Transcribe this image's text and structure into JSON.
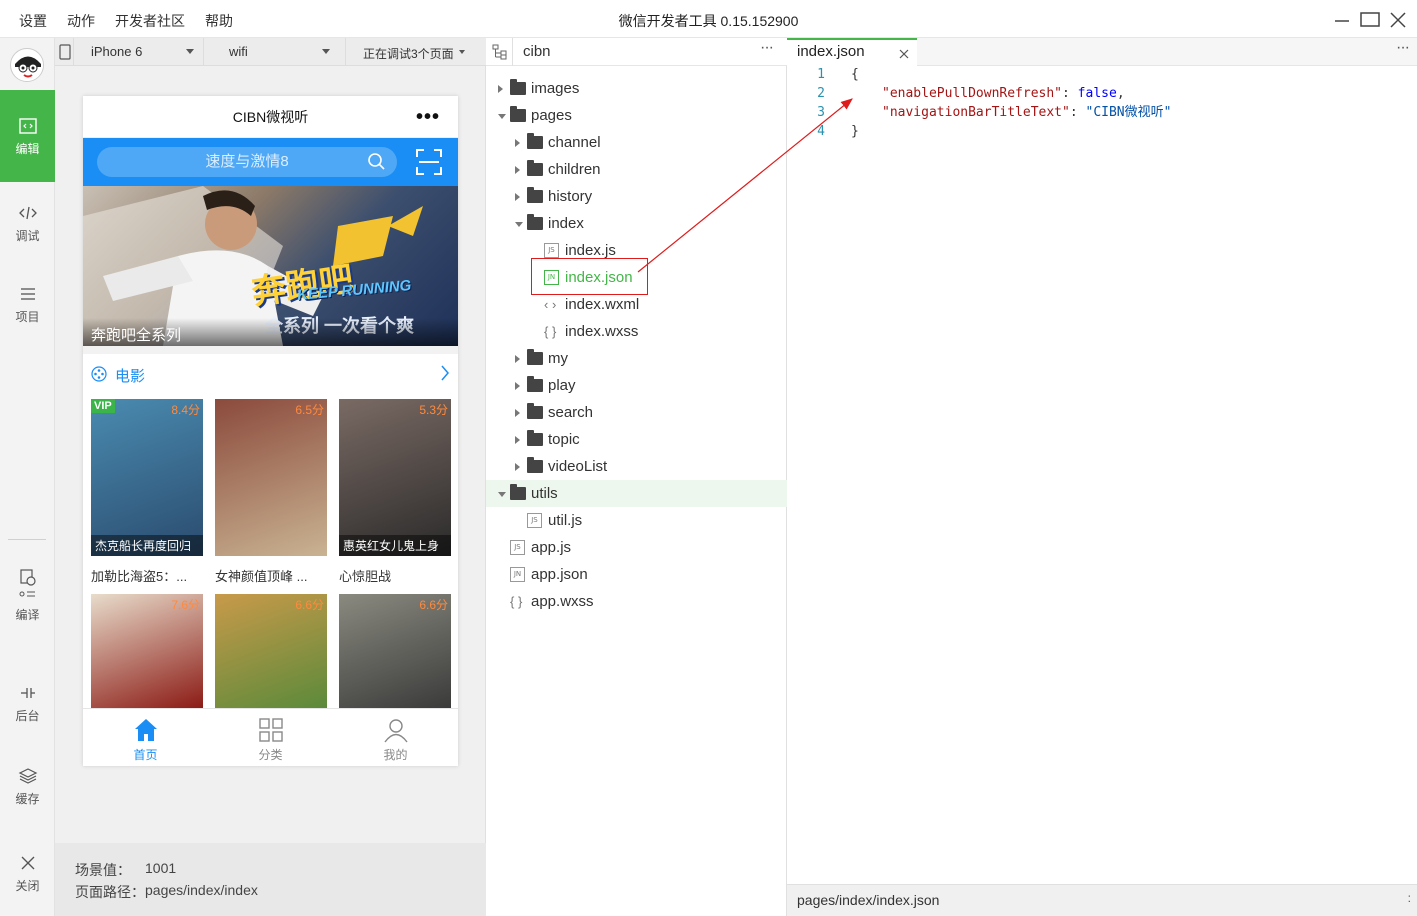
{
  "menu": [
    "设置",
    "动作",
    "开发者社区",
    "帮助"
  ],
  "app_title": "微信开发者工具 0.15.152900",
  "sidebar": {
    "items": [
      {
        "label": "编辑",
        "icon": "code-brackets-icon",
        "active": true
      },
      {
        "label": "调试",
        "icon": "debug-code-icon"
      },
      {
        "label": "项目",
        "icon": "menu-lines-icon"
      },
      {
        "label": "编译",
        "icon": "compile-icon"
      },
      {
        "label": "后台",
        "icon": "background-icon"
      },
      {
        "label": "缓存",
        "icon": "layers-icon"
      },
      {
        "label": "关闭",
        "icon": "close-icon"
      }
    ]
  },
  "simulator": {
    "device": "iPhone 6",
    "network": "wifi",
    "debug_status": "正在调试3个页面",
    "nav_title": "CIBN微视听",
    "search_placeholder": "速度与激情8",
    "banner_caption": "奔跑吧全系列",
    "banner_logo": "奔跑吧",
    "banner_logo_en": "KEEP RUNNING",
    "banner_slogan": "全系列 一次看个爽",
    "section_title": "电影",
    "movies": [
      {
        "title": "加勒比海盗5：...",
        "score": "8.4分",
        "badge": "VIP",
        "caption": "杰克船长再度回归",
        "colors": [
          "#2a4b6e",
          "#4a8bb0"
        ]
      },
      {
        "title": "女神颜值顶峰 ...",
        "score": "6.5分",
        "badge": "",
        "caption": "",
        "colors": [
          "#c9b392",
          "#8b4a3c"
        ]
      },
      {
        "title": "心惊胆战",
        "score": "5.3分",
        "badge": "",
        "caption": "惠英红女儿鬼上身",
        "colors": [
          "#2a2a2a",
          "#7a6a64"
        ]
      },
      {
        "title": "",
        "score": "7.6分",
        "badge": "",
        "caption": "",
        "colors": [
          "#8b1a14",
          "#e8dccb"
        ]
      },
      {
        "title": "",
        "score": "6.6分",
        "badge": "",
        "caption": "",
        "colors": [
          "#5a8a3a",
          "#c89a4a"
        ]
      },
      {
        "title": "",
        "score": "6.6分",
        "badge": "",
        "caption": "",
        "colors": [
          "#3a3a3a",
          "#8a8a80"
        ]
      }
    ],
    "tabs": [
      {
        "label": "首页",
        "icon": "home-icon",
        "active": true
      },
      {
        "label": "分类",
        "icon": "grid-icon",
        "active": false
      },
      {
        "label": "我的",
        "icon": "user-icon",
        "active": false
      }
    ],
    "scene_label": "场景值：",
    "scene_value": "1001",
    "path_label": "页面路径：",
    "path_value": "pages/index/index"
  },
  "project": {
    "name": "cibn",
    "tree": [
      {
        "name": "images",
        "type": "folder",
        "depth": 0,
        "expanded": false
      },
      {
        "name": "pages",
        "type": "folder",
        "depth": 0,
        "expanded": true
      },
      {
        "name": "channel",
        "type": "folder",
        "depth": 1,
        "expanded": false
      },
      {
        "name": "children",
        "type": "folder",
        "depth": 1,
        "expanded": false
      },
      {
        "name": "history",
        "type": "folder",
        "depth": 1,
        "expanded": false
      },
      {
        "name": "index",
        "type": "folder",
        "depth": 1,
        "expanded": true
      },
      {
        "name": "index.js",
        "type": "js",
        "depth": 2
      },
      {
        "name": "index.json",
        "type": "json",
        "depth": 2,
        "highlight": true
      },
      {
        "name": "index.wxml",
        "type": "wxml",
        "depth": 2
      },
      {
        "name": "index.wxss",
        "type": "wxss",
        "depth": 2
      },
      {
        "name": "my",
        "type": "folder",
        "depth": 1,
        "expanded": false
      },
      {
        "name": "play",
        "type": "folder",
        "depth": 1,
        "expanded": false
      },
      {
        "name": "search",
        "type": "folder",
        "depth": 1,
        "expanded": false
      },
      {
        "name": "topic",
        "type": "folder",
        "depth": 1,
        "expanded": false
      },
      {
        "name": "videoList",
        "type": "folder",
        "depth": 1,
        "expanded": false
      },
      {
        "name": "utils",
        "type": "folder",
        "depth": 0,
        "expanded": true,
        "selected": true
      },
      {
        "name": "util.js",
        "type": "js",
        "depth": 1
      },
      {
        "name": "app.js",
        "type": "js",
        "depth": 0
      },
      {
        "name": "app.json",
        "type": "json",
        "depth": 0
      },
      {
        "name": "app.wxss",
        "type": "wxss",
        "depth": 0
      }
    ]
  },
  "editor": {
    "tab_label": "index.json",
    "lines": [
      {
        "num": "1",
        "text": "{"
      },
      {
        "num": "2",
        "key": "\"enablePullDownRefresh\"",
        "sep": ": ",
        "val": "false",
        "vtype": "b",
        "tail": ","
      },
      {
        "num": "3",
        "key": "\"navigationBarTitleText\"",
        "sep": ": ",
        "val": "\"CIBN微视听\"",
        "vtype": "s",
        "tail": ""
      },
      {
        "num": "4",
        "text": "}"
      }
    ],
    "status_path": "pages/index/index.json"
  },
  "colors": {
    "accent": "#44b549",
    "primary_blue": "#1a8ef4",
    "annotation_red": "#e01b1b"
  }
}
